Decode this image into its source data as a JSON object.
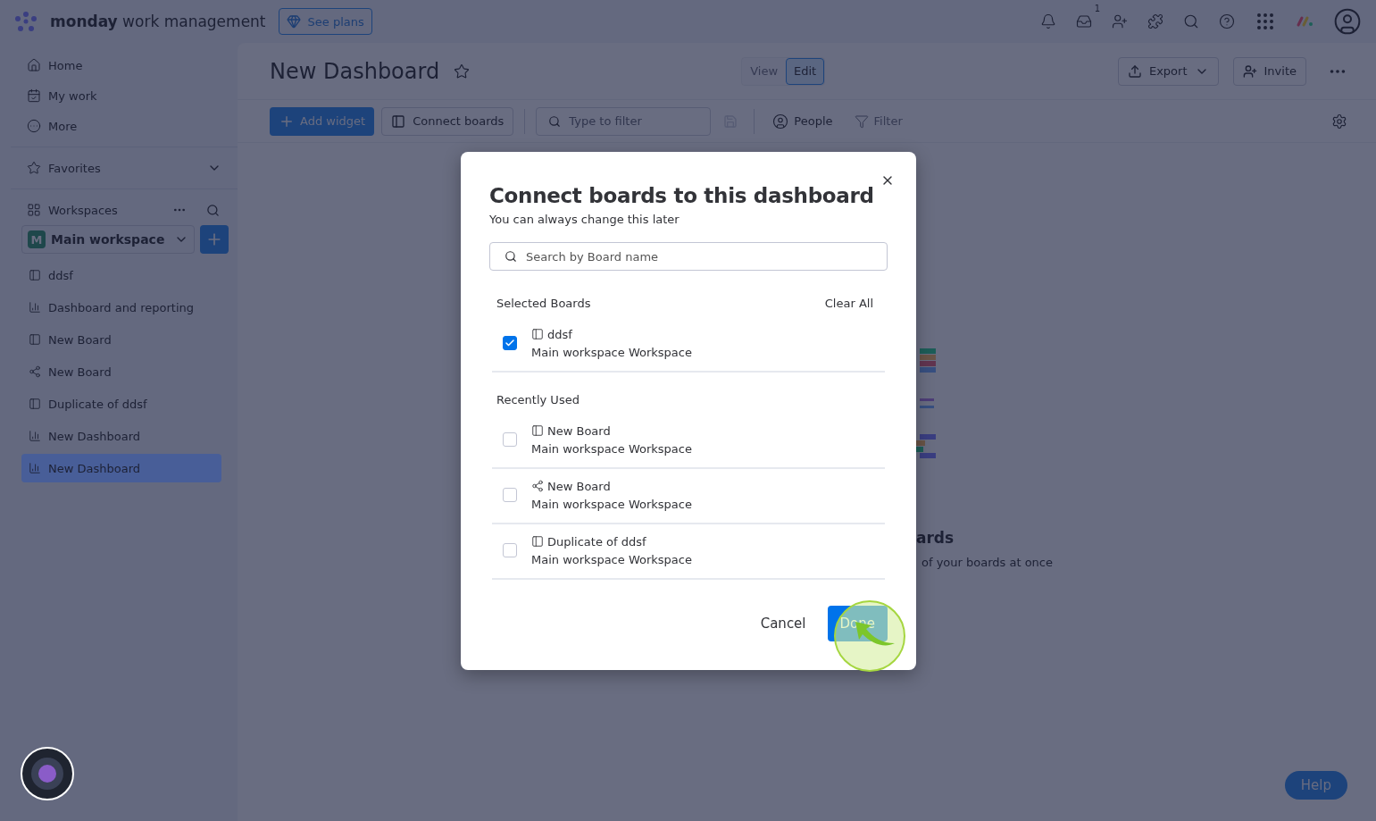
{
  "topbar": {
    "logo_bold": "monday",
    "logo_rest": "work management",
    "see_plans": "See plans",
    "inbox_badge": "1"
  },
  "sidebar": {
    "nav": [
      {
        "label": "Home",
        "kind": "home"
      },
      {
        "label": "My work",
        "kind": "mywork"
      },
      {
        "label": "More",
        "kind": "more"
      }
    ],
    "favorites": "Favorites",
    "workspaces": "Workspaces",
    "workspace": {
      "name": "Main workspace",
      "avatar": "M"
    },
    "items": [
      {
        "label": "ddsf",
        "kind": "board",
        "selected": false
      },
      {
        "label": "Dashboard and reporting",
        "kind": "dashboard",
        "selected": false
      },
      {
        "label": "New Board",
        "kind": "board",
        "selected": false
      },
      {
        "label": "New Board",
        "kind": "shared",
        "selected": false
      },
      {
        "label": "Duplicate of ddsf",
        "kind": "board",
        "selected": false
      },
      {
        "label": "New Dashboard",
        "kind": "dashboard",
        "selected": false
      },
      {
        "label": "New Dashboard",
        "kind": "dashboard",
        "selected": true
      }
    ]
  },
  "header": {
    "title": "New Dashboard",
    "modes": [
      {
        "label": "View",
        "selected": false
      },
      {
        "label": "Edit",
        "selected": true
      }
    ],
    "export": "Export",
    "invite": "Invite"
  },
  "toolbar": {
    "add_widget": "Add widget",
    "connect_boards": "Connect boards",
    "filter_placeholder": "Type to filter",
    "people": "People",
    "filter": {
      "label": "Filter",
      "disabled": true
    }
  },
  "empty_state": {
    "title": "ards",
    "subtitle": "of your boards at once"
  },
  "dialog": {
    "title": "Connect boards to this dashboard",
    "subtitle": "You can always change this later",
    "search_placeholder": "Search by Board name",
    "selected_heading": "Selected Boards",
    "clear_all": "Clear All",
    "selected": [
      {
        "name": "ddsf",
        "workspace": "Main workspace Workspace",
        "kind": "board",
        "checked": true
      }
    ],
    "recent_heading": "Recently Used",
    "recent": [
      {
        "name": "New Board",
        "workspace": "Main workspace Workspace",
        "kind": "board",
        "checked": false
      },
      {
        "name": "New Board",
        "workspace": "Main workspace Workspace",
        "kind": "shared",
        "checked": false
      },
      {
        "name": "Duplicate of ddsf",
        "workspace": "Main workspace Workspace",
        "kind": "board",
        "checked": false
      }
    ],
    "cancel": "Cancel",
    "done": "Done"
  },
  "help": "Help"
}
